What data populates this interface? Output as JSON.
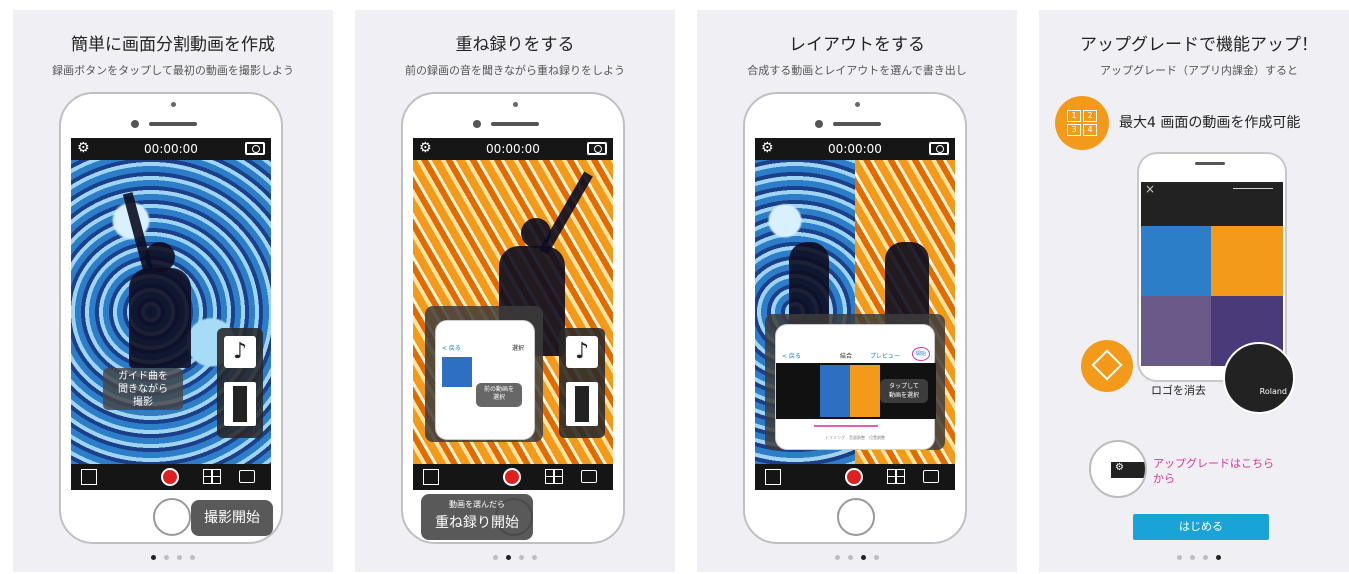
{
  "panels": [
    {
      "title": "簡単に画面分割動画を作成",
      "subtitle": "録画ボタンをタップして最初の動画を撮影しよう",
      "timer": "00:00:00",
      "tip_line1": "ガイド曲を",
      "tip_line2": "聞きながら",
      "tip_line3": "撮影",
      "callout": "撮影開始",
      "media_note": "♪"
    },
    {
      "title": "重ね録りをする",
      "subtitle": "前の録画の音を聞きながら重ね録りをしよう",
      "timer": "00:00:00",
      "mini_back": "< 戻る",
      "mini_select": "選択",
      "mini_tip_line1": "前の動画を",
      "mini_tip_line2": "選択",
      "callout_small": "動画を選んだら",
      "callout": "重ね録り開始",
      "media_note": "♪"
    },
    {
      "title": "レイアウトをする",
      "subtitle": "合成する動画とレイアウトを選んで書き出し",
      "timer": "00:00:00",
      "mini_back": "< 戻る",
      "mini_merge": "結合",
      "mini_preview": "プレビュー",
      "mini_start": "開始",
      "mini_tip_line1": "タップして",
      "mini_tip_line2": "動画を選択",
      "mini_bottom": "トリミング　音量調整　位置調整"
    },
    {
      "title": "アップグレードで機能アップ！",
      "subtitle": "アップグレード（アプリ内課金）すると",
      "feature1": "最大4 画面の動画を作成可能",
      "grid_nums": [
        "1",
        "2",
        "3",
        "4"
      ],
      "close": "×",
      "feature2": "ロゴを消去",
      "brand": "Roland",
      "feature3_line1": "アップグレードはこちら",
      "feature3_line2": "から",
      "start_button": "はじめる"
    }
  ],
  "colors": {
    "panel_bg": "#f0f0f4",
    "accent_orange": "#f39a1a",
    "record_red": "#e02020",
    "upgrade_pink": "#e0339a",
    "start_blue": "#1aa3d6"
  }
}
